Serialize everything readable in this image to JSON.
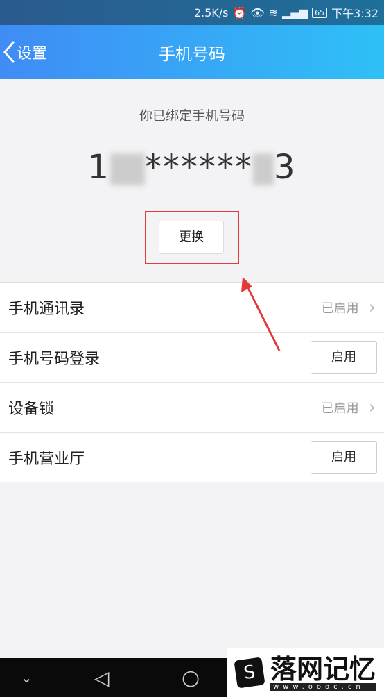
{
  "status": {
    "speed": "2.5K/s",
    "icons": [
      "alarm-icon",
      "eye-icon",
      "wifi-icon",
      "4g-signal-icon"
    ],
    "battery": "65",
    "time": "下午3:32"
  },
  "nav": {
    "back_label": "设置",
    "title": "手机号码"
  },
  "phone": {
    "bound_text": "你已绑定手机号码",
    "prefix": "1",
    "masked": "******",
    "suffix": "3",
    "change_label": "更换"
  },
  "rows": [
    {
      "label": "手机通讯录",
      "status": "已启用"
    },
    {
      "label": "手机号码登录",
      "button": "启用"
    },
    {
      "label": "设备锁",
      "status": "已启用"
    },
    {
      "label": "手机营业厅",
      "button": "启用"
    }
  ],
  "watermark": {
    "text": "落网记忆",
    "url": "www.oooc.cn"
  },
  "colors": {
    "nav_start": "#3f8cf5",
    "nav_end": "#2fc0f7",
    "highlight": "#e23b3b"
  }
}
